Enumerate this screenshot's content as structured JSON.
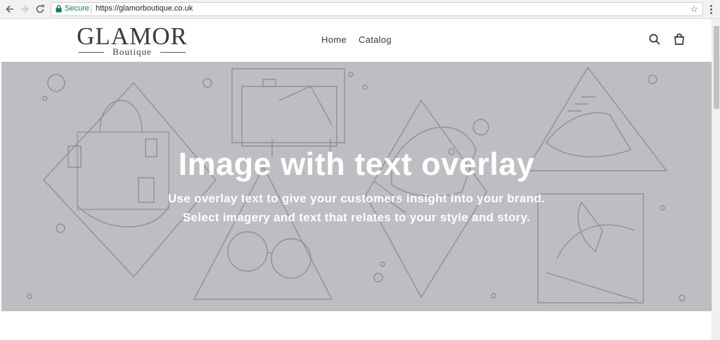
{
  "browser": {
    "secure_label": "Secure",
    "url": "https://glamorboutique.co.uk"
  },
  "header": {
    "logo_main": "GLAMOR",
    "logo_sub": "Boutique",
    "nav": [
      "Home",
      "Catalog"
    ],
    "icons": [
      "search-icon",
      "cart-icon"
    ]
  },
  "hero": {
    "title": "Image with text overlay",
    "subtitle_line1": "Use overlay text to give your customers insight into your brand.",
    "subtitle_line2": "Select imagery and text that relates to your style and story."
  },
  "colors": {
    "hero_background": "#bdbec1",
    "secure_green": "#0b8043",
    "text_dark": "#3a3a3a"
  }
}
